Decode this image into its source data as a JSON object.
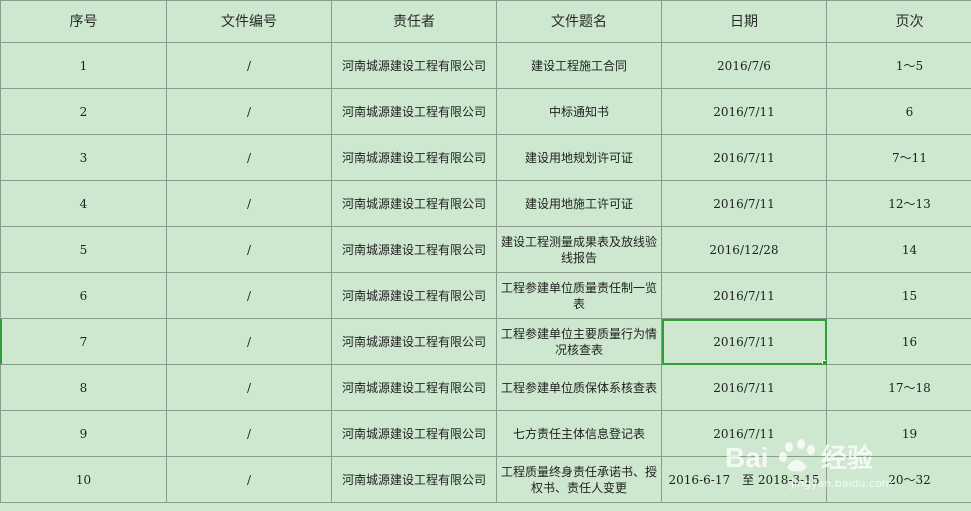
{
  "headers": [
    "序号",
    "文件编号",
    "责任者",
    "文件题名",
    "日期",
    "页次"
  ],
  "rows": [
    {
      "no": "1",
      "code": "/",
      "owner": "河南城源建设工程有限公司",
      "title": "建设工程施工合同",
      "date": "2016/7/6",
      "pages": "1～5"
    },
    {
      "no": "2",
      "code": "/",
      "owner": "河南城源建设工程有限公司",
      "title": "中标通知书",
      "date": "2016/7/11",
      "pages": "6"
    },
    {
      "no": "3",
      "code": "/",
      "owner": "河南城源建设工程有限公司",
      "title": "建设用地规划许可证",
      "date": "2016/7/11",
      "pages": "7～11"
    },
    {
      "no": "4",
      "code": "/",
      "owner": "河南城源建设工程有限公司",
      "title": "建设用地施工许可证",
      "date": "2016/7/11",
      "pages": "12～13"
    },
    {
      "no": "5",
      "code": "/",
      "owner": "河南城源建设工程有限公司",
      "title": "建设工程测量成果表及放线验线报告",
      "date": "2016/12/28",
      "pages": "14"
    },
    {
      "no": "6",
      "code": "/",
      "owner": "河南城源建设工程有限公司",
      "title": "工程参建单位质量责任制一览表",
      "date": "2016/7/11",
      "pages": "15"
    },
    {
      "no": "7",
      "code": "/",
      "owner": "河南城源建设工程有限公司",
      "title": "工程参建单位主要质量行为情况核查表",
      "date": "2016/7/11",
      "pages": "16"
    },
    {
      "no": "8",
      "code": "/",
      "owner": "河南城源建设工程有限公司",
      "title": "工程参建单位质保体系核查表",
      "date": "2016/7/11",
      "pages": "17～18"
    },
    {
      "no": "9",
      "code": "/",
      "owner": "河南城源建设工程有限公司",
      "title": "七方责任主体信息登记表",
      "date": "2016/7/11",
      "pages": "19"
    },
    {
      "no": "10",
      "code": "/",
      "owner": "河南城源建设工程有限公司",
      "title": "工程质量终身责任承诺书、授权书、责任人变更",
      "date": "2016-6-17　至 2018-3-15",
      "pages": "20～32"
    }
  ],
  "watermark": {
    "brand": "Bai",
    "brand_tail": "经验",
    "url": "jingyan.baidu.com"
  },
  "colors": {
    "background": "#cde8cf",
    "grid": "#8a9a8b",
    "selection": "#2e9e3a"
  }
}
